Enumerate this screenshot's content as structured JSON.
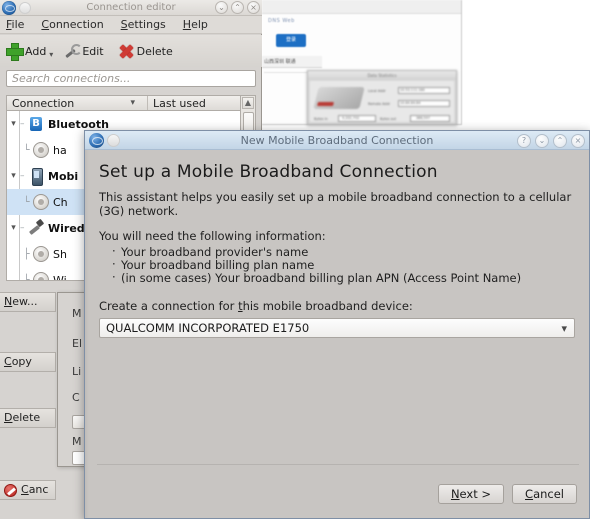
{
  "editor_window": {
    "title": "Connection editor",
    "icons": {
      "app": "globe-icon",
      "secondary": "blank-icon"
    },
    "window_buttons": [
      {
        "name": "minimize-button",
        "glyph": "⌄"
      },
      {
        "name": "maximize-button",
        "glyph": "⌃"
      },
      {
        "name": "close-button",
        "glyph": "×"
      }
    ],
    "menu": [
      {
        "label": "File",
        "mnemonic": "F"
      },
      {
        "label": "Connection",
        "mnemonic": "C"
      },
      {
        "label": "Settings",
        "mnemonic": "S"
      },
      {
        "label": "Help",
        "mnemonic": "H"
      }
    ],
    "toolbar": [
      {
        "name": "add-button",
        "label": "Add",
        "icon": "plus-icon",
        "has_dropdown": true
      },
      {
        "name": "edit-button",
        "label": "Edit",
        "icon": "wrench-icon"
      },
      {
        "name": "delete-button",
        "label": "Delete",
        "icon": "x-icon"
      }
    ],
    "search": {
      "placeholder": "Search connections...",
      "value": ""
    },
    "list_header": {
      "col1": "Connection",
      "col2": "Last used",
      "sort_glyph": "⌄"
    },
    "tree": [
      {
        "label": "Bluetooth",
        "icon": "bluetooth-icon",
        "type": "group",
        "expander": "⌄"
      },
      {
        "label": "ha",
        "icon": "connection-icon",
        "type": "leaf"
      },
      {
        "label": "Mobi",
        "icon": "phone-icon",
        "type": "group",
        "expander": "⌄"
      },
      {
        "label": "Ch",
        "icon": "connection-icon",
        "type": "leaf",
        "selected": true
      },
      {
        "label": "Wired",
        "icon": "plug-icon",
        "type": "group",
        "expander": "⌄"
      },
      {
        "label": "Sh",
        "icon": "connection-icon",
        "type": "leaf"
      },
      {
        "label": "Wi",
        "icon": "connection-icon",
        "type": "leaf"
      }
    ],
    "side_buttons": [
      {
        "name": "new-button",
        "label": "New...",
        "mnemonic": "N"
      },
      {
        "name": "copy-button",
        "label": "Copy",
        "mnemonic": "C"
      },
      {
        "name": "delete-button",
        "label": "Delete",
        "mnemonic": "D"
      },
      {
        "name": "cancel-button",
        "label": "Canc",
        "mnemonic": "C",
        "icon": "cancel-icon"
      }
    ]
  },
  "background_dialog": {
    "labels": [
      "M",
      "El",
      "Li",
      "C",
      "M"
    ]
  },
  "background_browser": {
    "link_text": "DNS     Web",
    "button_text": "登录",
    "tab_text": "山西深圳 联通",
    "inner_dialog": {
      "title": "Data Statistics",
      "fields": [
        {
          "label": "Local Addr",
          "value": "10.53.111.180"
        },
        {
          "label": "Remote Addr",
          "value": "10.64.64.64"
        },
        {
          "label": "Bytes in",
          "value": "9,332,702"
        },
        {
          "label": "Bytes out",
          "value": "388,597"
        }
      ]
    }
  },
  "wizard": {
    "title": "New Mobile Broadband Connection",
    "icons": {
      "app": "globe-icon",
      "secondary": "blank-icon"
    },
    "window_buttons": [
      {
        "name": "help-button",
        "glyph": "?"
      },
      {
        "name": "minimize-button",
        "glyph": "⌄"
      },
      {
        "name": "maximize-button",
        "glyph": "⌃"
      },
      {
        "name": "close-button",
        "glyph": "×"
      }
    ],
    "heading": "Set up a Mobile Broadband Connection",
    "intro": "This assistant helps you easily set up a mobile broadband connection to a cellular (3G) network.",
    "requirements_title": "You will need the following information:",
    "requirements": [
      "Your broadband provider's name",
      "Your broadband billing plan name",
      "(in some cases) Your broadband billing plan APN (Access Point Name)"
    ],
    "device_label_before": "Create a connection for ",
    "device_label_mnemonic": "t",
    "device_label_after": "his mobile broadband device:",
    "device_combo": {
      "value": "QUALCOMM INCORPORATED E1750",
      "arrow": "⌄"
    },
    "actions": [
      {
        "name": "next-button",
        "label_before": "",
        "mnemonic": "N",
        "label_after": "ext >"
      },
      {
        "name": "cancel-button",
        "label_before": "",
        "mnemonic": "C",
        "label_after": "ancel"
      }
    ]
  },
  "colors": {
    "dialog_bg": "#c8c5c2",
    "editor_bg": "#d6d3d0",
    "title_active": "#c3d5e6",
    "selection": "#cfe2f5",
    "accent_green": "#3fa22a",
    "accent_red": "#cf3b35"
  }
}
